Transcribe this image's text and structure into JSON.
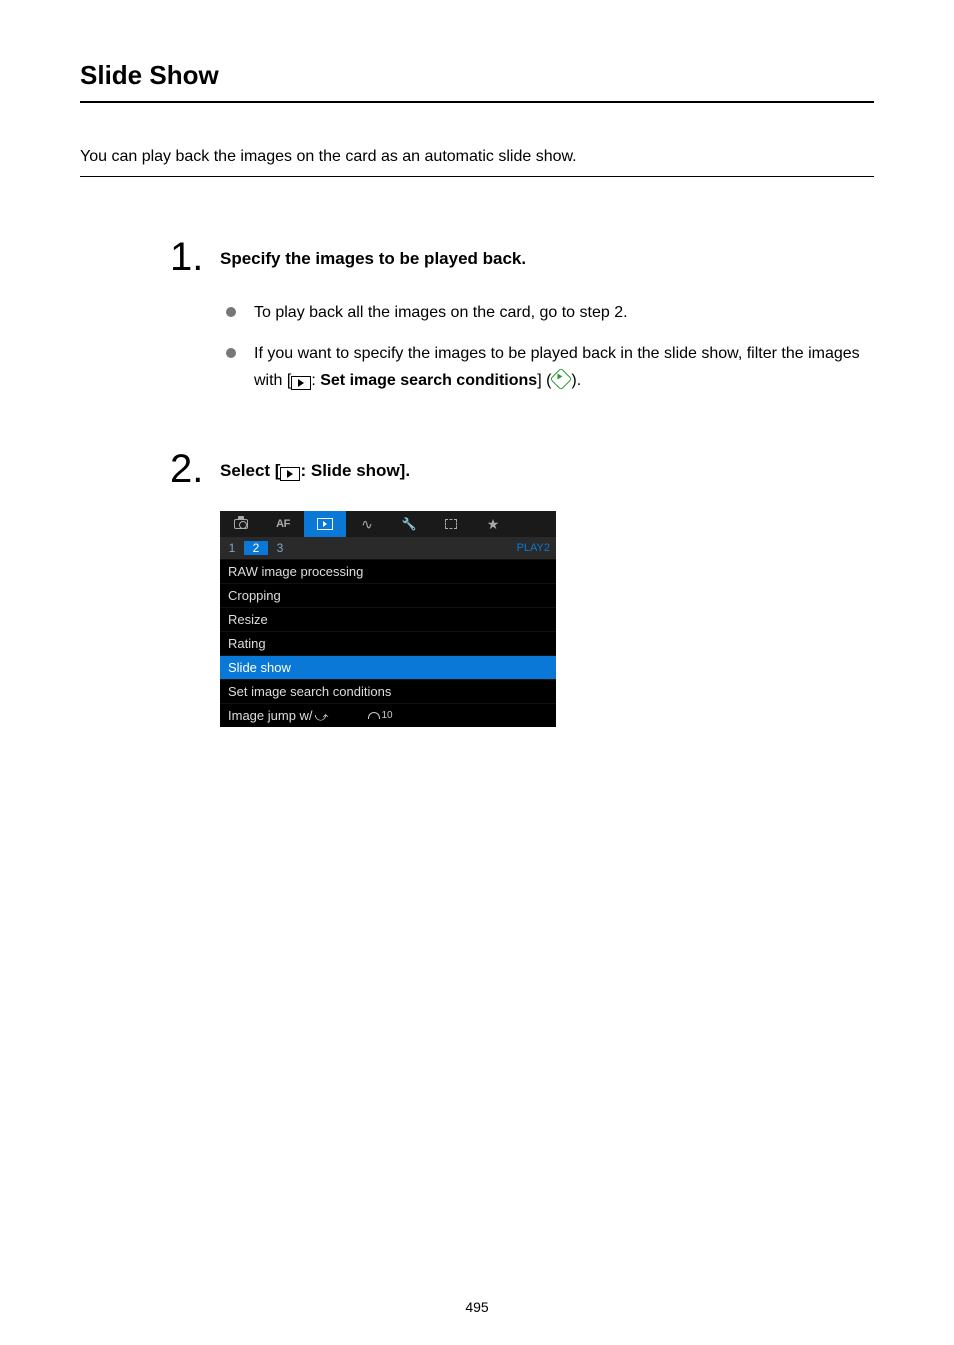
{
  "title": "Slide Show",
  "intro": "You can play back the images on the card as an automatic slide show.",
  "step1": {
    "num": "1.",
    "heading": "Specify the images to be played back.",
    "bullet1": "To play back all the images on the card, go to step 2.",
    "bullet2_a": "If you want to specify the images to be played back in the slide show, filter the images with [",
    "bullet2_b": ": ",
    "bullet2_bold": "Set image search conditions",
    "bullet2_c": "] (",
    "bullet2_d": ")."
  },
  "step2": {
    "num": "2.",
    "heading_a": "Select [",
    "heading_b": ": Slide show]."
  },
  "menu": {
    "tab2_label": "AF",
    "sub1": "1",
    "sub2": "2",
    "sub3": "3",
    "page_label": "PLAY2",
    "row1": "RAW image processing",
    "row2": "Cropping",
    "row3": "Resize",
    "row4": "Rating",
    "row5": "Slide show",
    "row6": "Set image search conditions",
    "row7": "Image jump w/",
    "row7_val": "10"
  },
  "page_num": "495"
}
